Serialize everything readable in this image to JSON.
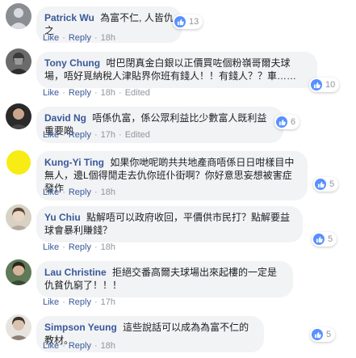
{
  "actions": {
    "like": "Like",
    "reply": "Reply",
    "separator": "·"
  },
  "colors": {
    "link": "#385898",
    "bubble": "#f2f3f5",
    "meta": "#90949c",
    "like_icon": "#5890ff"
  },
  "comments": [
    {
      "author": "Patrick Wu",
      "text": "為富不仁, 人皆仇之",
      "reactions": "13",
      "time": "18h",
      "edited": ""
    },
    {
      "author": "Tony Chung",
      "text": "咁巴閉真金白銀以正價買咗個粉嶺哥爾夫球場，唔好覓納稅人津貼界你班有錢人！！有錢人？？車……",
      "reactions": "10",
      "time": "18h",
      "edited": "Edited"
    },
    {
      "author": "David Ng",
      "text": "唔係仇富，係公眾利益比少數富人既利益重要啲",
      "reactions": "6",
      "time": "17h",
      "edited": "Edited"
    },
    {
      "author": "Kung-Yi Ting",
      "text": "如果你哋呢啲共共地產商唔係日日咁樣目中無人，邊L個得閒走去仇你班仆街啊？你好意思妄想被害症發作",
      "reactions": "5",
      "time": "18h",
      "edited": ""
    },
    {
      "author": "Yu Chiu",
      "text": "點解唔可以政府收回，平價供市民打？點解要益球會暴利賺錢？",
      "reactions": "5",
      "time": "18h",
      "edited": ""
    },
    {
      "author": "Lau Christine",
      "text": "拒絕交番高爾夫球場出來起樓的一定是仇貧仇窮了！！！",
      "reactions": "",
      "time": "17h",
      "edited": ""
    },
    {
      "author": "Simpson Yeung",
      "text": "這些說話可以成為為富不仁的教材。",
      "reactions": "5",
      "time": "18h",
      "edited": ""
    }
  ]
}
